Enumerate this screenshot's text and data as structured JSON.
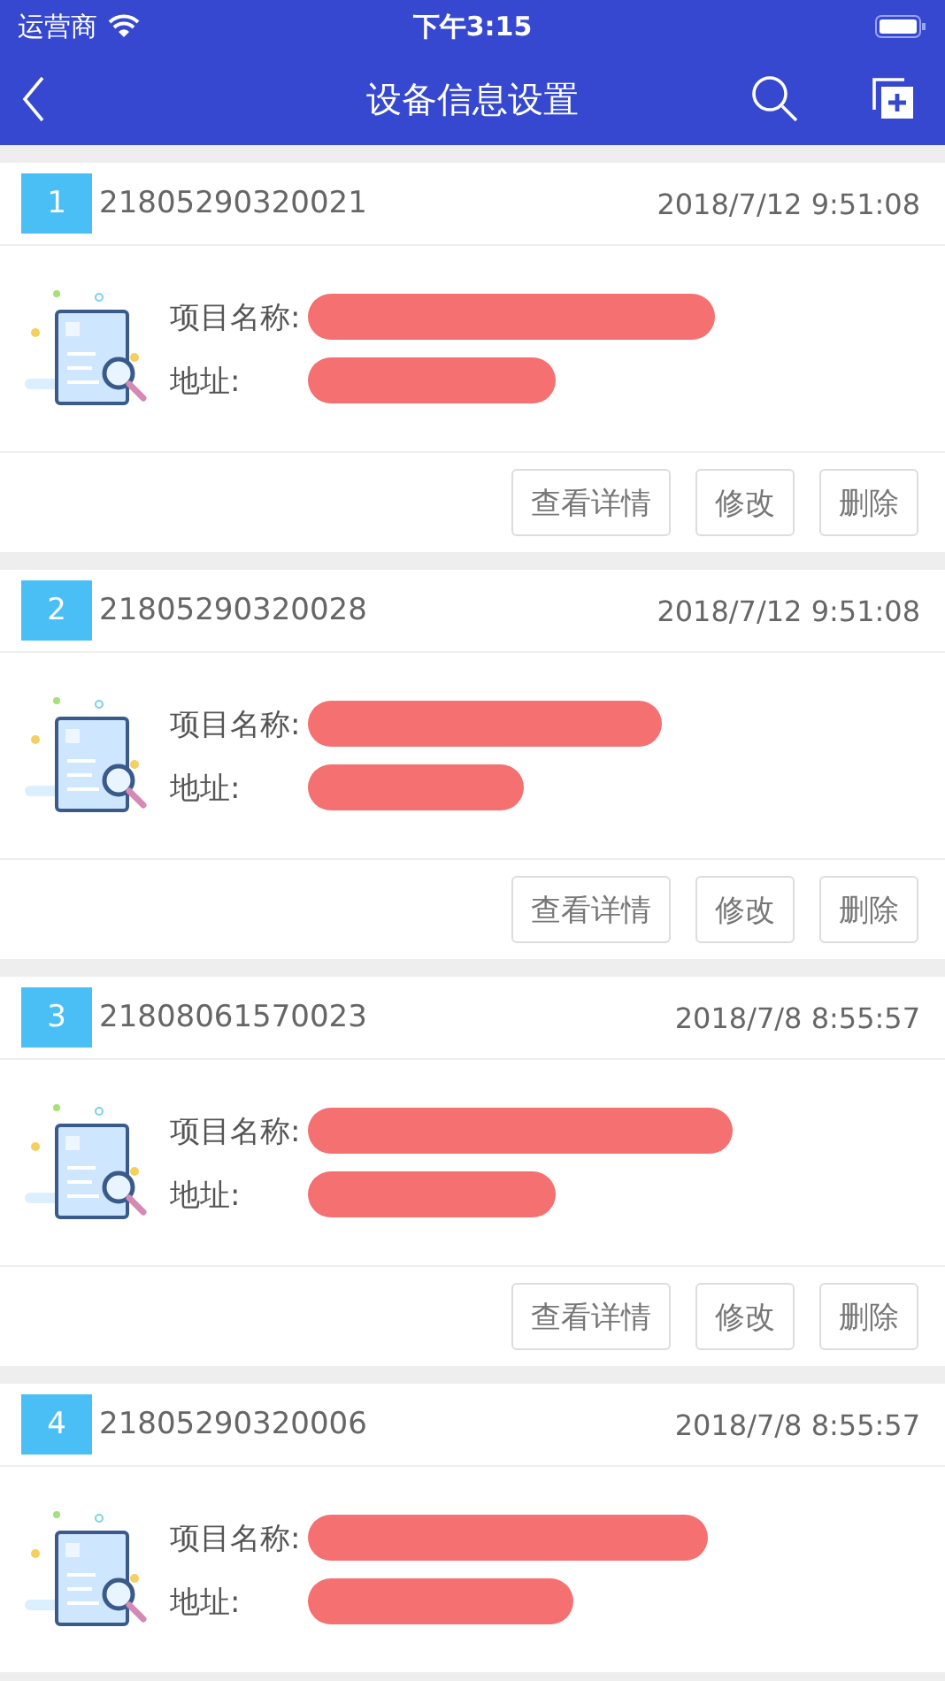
{
  "status_bar": {
    "carrier": "运营商",
    "time": "下午3:15"
  },
  "header": {
    "title": "设备信息设置"
  },
  "records": [
    {
      "index": "1",
      "code": "21805290320021",
      "time": "2018/7/12 9:51:08",
      "name_label": "项目名称:",
      "address_label": "地址:",
      "buttons": [
        "查看详情",
        "修改",
        "删除"
      ]
    },
    {
      "index": "2",
      "code": "21805290320028",
      "time": "2018/7/12 9:51:08",
      "name_label": "项目名称:",
      "address_label": "地址:",
      "buttons": [
        "查看详情",
        "修改",
        "删除"
      ]
    },
    {
      "index": "3",
      "code": "21808061570023",
      "time": "2018/7/8 8:55:57",
      "name_label": "项目名称:",
      "address_label": "地址:",
      "buttons": [
        "查看详情",
        "修改",
        "删除"
      ]
    },
    {
      "index": "4",
      "code": "21805290320006",
      "time": "2018/7/8 8:55:57",
      "name_label": "项目名称:",
      "address_label": "地址:"
    }
  ]
}
